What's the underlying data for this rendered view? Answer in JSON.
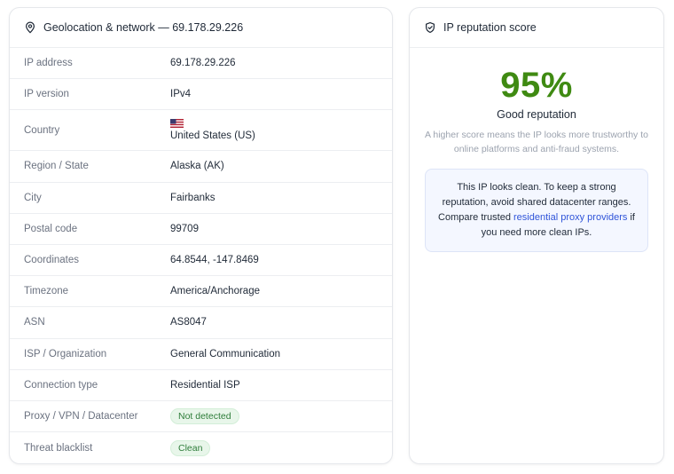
{
  "geo": {
    "title": "Geolocation & network — 69.178.29.226",
    "rows": [
      {
        "key": "IP address",
        "value": "69.178.29.226"
      },
      {
        "key": "IP version",
        "value": "IPv4"
      },
      {
        "key": "Country",
        "value": "United States (US)",
        "flag_icon": "us-flag-icon"
      },
      {
        "key": "Region / State",
        "value": "Alaska (AK)"
      },
      {
        "key": "City",
        "value": "Fairbanks"
      },
      {
        "key": "Postal code",
        "value": "99709"
      },
      {
        "key": "Coordinates",
        "value": "64.8544, -147.8469"
      },
      {
        "key": "Timezone",
        "value": "America/Anchorage"
      },
      {
        "key": "ASN",
        "value": "AS8047"
      },
      {
        "key": "ISP / Organization",
        "value": "General Communication"
      },
      {
        "key": "Connection type",
        "value": "Residential ISP"
      },
      {
        "key": "Proxy / VPN / Datacenter",
        "value": "Not detected"
      },
      {
        "key": "Threat blacklist",
        "value": "Clean"
      }
    ]
  },
  "reputation": {
    "title": "IP reputation score",
    "score": "95%",
    "label": "Good reputation",
    "description": "A higher score means the IP looks more trustworthy to online platforms and anti-fraud systems.",
    "notice_before": "This IP looks clean. To keep a strong reputation, avoid shared datacenter ranges. Compare trusted ",
    "notice_link": "residential proxy providers",
    "notice_after": " if you need more clean IPs."
  },
  "colors": {
    "score": "#3f8a12",
    "link": "#2f54d9",
    "pill_bg": "#e8f6ea",
    "pill_text": "#2e7d3a"
  }
}
